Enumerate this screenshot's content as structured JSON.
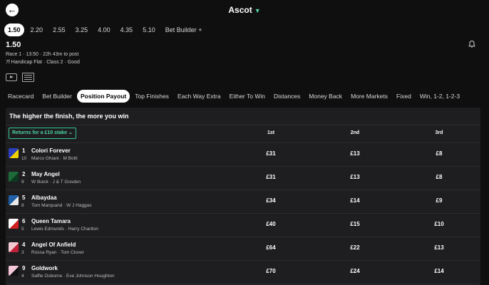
{
  "header": {
    "back_icon": "arrow-left-icon",
    "venue": "Ascot",
    "venue_chevron": "chevron-down-icon"
  },
  "race_times": [
    {
      "label": "1.50",
      "active": true
    },
    {
      "label": "2.20",
      "active": false
    },
    {
      "label": "2.55",
      "active": false
    },
    {
      "label": "3.25",
      "active": false
    },
    {
      "label": "4.00",
      "active": false
    },
    {
      "label": "4.35",
      "active": false
    },
    {
      "label": "5.10",
      "active": false
    },
    {
      "label": "Bet Builder +",
      "active": false
    }
  ],
  "race": {
    "time": "1.50",
    "meta_line1": "Race 1 · 13:50 · 22h 43m to post",
    "meta_line2": "7f Handicap Flat · Class 2 · Good"
  },
  "tabs": [
    {
      "label": "Racecard",
      "active": false
    },
    {
      "label": "Bet Builder",
      "active": false
    },
    {
      "label": "Position Payout",
      "active": true
    },
    {
      "label": "Top Finishes",
      "active": false
    },
    {
      "label": "Each Way Extra",
      "active": false
    },
    {
      "label": "Either To Win",
      "active": false
    },
    {
      "label": "Distances",
      "active": false
    },
    {
      "label": "Money Back",
      "active": false
    },
    {
      "label": "More Markets",
      "active": false
    },
    {
      "label": "Fixed",
      "active": false
    },
    {
      "label": "Win, 1-2, 1-2-3",
      "active": false
    }
  ],
  "payout": {
    "title": "The higher the finish, the more you win",
    "stake_label": "Returns for a £10 stake",
    "col_1st": "1st",
    "col_2nd": "2nd",
    "col_3rd": "3rd",
    "accent": "#36c48e"
  },
  "runners": [
    {
      "num": "1",
      "stall": "10",
      "name": "Colori Forever",
      "jockey": "Marco Ghiani",
      "trainer": "M Botti",
      "p1": "£31",
      "p2": "£13",
      "p3": "£8",
      "silk": "#2b3fbf",
      "silk2": "#f0d000"
    },
    {
      "num": "2",
      "stall": "9",
      "name": "May Angel",
      "jockey": "W Buick",
      "trainer": "J & T Gosden",
      "p1": "£31",
      "p2": "£13",
      "p3": "£8",
      "silk": "#1f6a3a",
      "silk2": "#0b3a20"
    },
    {
      "num": "5",
      "stall": "8",
      "name": "Albaydaa",
      "jockey": "Tom Marquand",
      "trainer": "W J Haggas",
      "p1": "£34",
      "p2": "£14",
      "p3": "£9",
      "silk": "#1f5fa8",
      "silk2": "#e8e8e8"
    },
    {
      "num": "6",
      "stall": "5",
      "name": "Queen Tamara",
      "jockey": "Lewis Edmunds",
      "trainer": "Harry Charlton",
      "p1": "£40",
      "p2": "£15",
      "p3": "£10",
      "silk": "#ffffff",
      "silk2": "#d12020"
    },
    {
      "num": "4",
      "stall": "3",
      "name": "Angel Of Anfield",
      "jockey": "Rossa Ryan",
      "trainer": "Tom Clover",
      "p1": "£64",
      "p2": "£22",
      "p3": "£13",
      "silk": "#f2c9d2",
      "silk2": "#c0203a"
    },
    {
      "num": "9",
      "stall": "4",
      "name": "Goldwork",
      "jockey": "Saffie Osborne",
      "trainer": "Eve Johnson Houghton",
      "p1": "£70",
      "p2": "£24",
      "p3": "£14",
      "silk": "#f3c6d8",
      "silk2": "#111111"
    }
  ]
}
